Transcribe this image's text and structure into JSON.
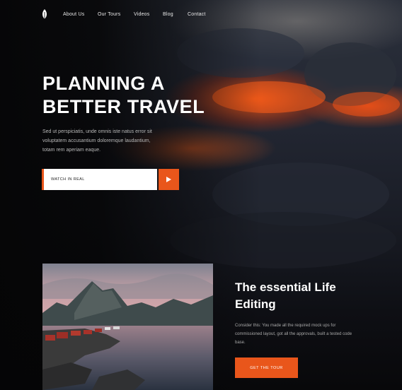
{
  "nav": {
    "items": [
      {
        "label": "About Us"
      },
      {
        "label": "Our Tours"
      },
      {
        "label": "Videos"
      },
      {
        "label": "Blog"
      },
      {
        "label": "Contact"
      }
    ]
  },
  "hero": {
    "headline_line1": "PLANNING A",
    "headline_line2": "BETTER TRAVEL",
    "intro": "Sed ut perspiciatis, unde omnis iste natus error sit voluptatem accusantium doloremque laudantium, totam rem aperiam eaque.",
    "watch_label": "WATCH IN REAL"
  },
  "feature": {
    "title_line1": "The essential Life",
    "title_line2": "Editing",
    "text": "Consider this: You made all the required mock ups for commissioned layout, got all the approvals, built a tested code base.",
    "button_label": "GET THE TOUR"
  },
  "colors": {
    "accent": "#e9561b",
    "background": "#0b0b0c"
  },
  "icons": {
    "logo": "leaf-logo-icon",
    "play": "play-icon"
  }
}
